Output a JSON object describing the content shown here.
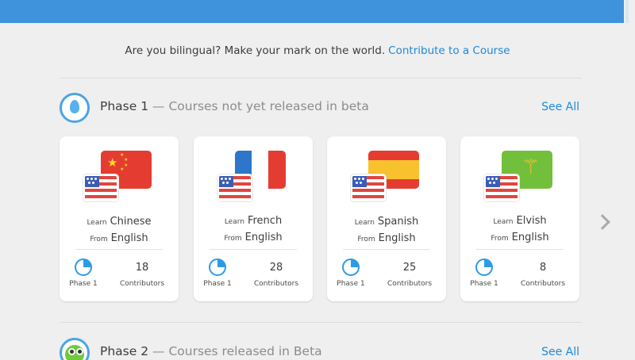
{
  "invite": {
    "text": "Are you bilingual?  Make your mark on the world.",
    "link": "Contribute to a Course"
  },
  "phases": [
    {
      "title": "Phase 1",
      "subtitle": "— Courses not yet released in beta",
      "see_all": "See All",
      "icon": "egg-icon"
    },
    {
      "title": "Phase 2",
      "subtitle": "— Courses released in Beta",
      "see_all": "See All",
      "icon": "owl-icon"
    }
  ],
  "courses": [
    {
      "learn_label": "Learn",
      "learn": "Chinese",
      "from_label": "From",
      "from": "English",
      "phase_label": "Phase 1",
      "phase_progress": 0.25,
      "contributors": "18",
      "contributors_label": "Contributors",
      "flag": "china-flag"
    },
    {
      "learn_label": "Learn",
      "learn": "French",
      "from_label": "From",
      "from": "English",
      "phase_label": "Phase 1",
      "phase_progress": 0.25,
      "contributors": "28",
      "contributors_label": "Contributors",
      "flag": "france-flag"
    },
    {
      "learn_label": "Learn",
      "learn": "Spanish",
      "from_label": "From",
      "from": "English",
      "phase_label": "Phase 1",
      "phase_progress": 0.25,
      "contributors": "25",
      "contributors_label": "Contributors",
      "flag": "spain-flag"
    },
    {
      "learn_label": "Learn",
      "learn": "Elvish",
      "from_label": "From",
      "from": "English",
      "phase_label": "Phase 1",
      "phase_progress": 0.25,
      "contributors": "8",
      "contributors_label": "Contributors",
      "flag": "elvish-flag"
    }
  ],
  "colors": {
    "topbar": "#3f93dc",
    "link": "#1e88d9",
    "accent": "#2b9be8"
  },
  "icons": {
    "next": "chevron-right-icon",
    "us_flag": "usa-flag"
  }
}
